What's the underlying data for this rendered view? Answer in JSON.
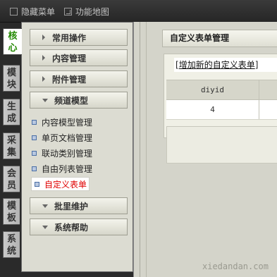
{
  "topbar": {
    "hide_menu": "隐藏菜单",
    "feature_map": "功能地图"
  },
  "vtabs": [
    {
      "label": "核\n心",
      "active": true
    },
    {
      "label": "模\n块",
      "active": false
    },
    {
      "label": "生\n成",
      "active": false
    },
    {
      "label": "采\n集",
      "active": false
    },
    {
      "label": "会\n员",
      "active": false
    },
    {
      "label": "模\n板",
      "active": false
    },
    {
      "label": "系\n统",
      "active": false
    }
  ],
  "menu": {
    "sections": [
      {
        "label": "常用操作",
        "expanded": false
      },
      {
        "label": "内容管理",
        "expanded": false
      },
      {
        "label": "附件管理",
        "expanded": false
      },
      {
        "label": "频道模型",
        "expanded": true
      },
      {
        "label": "批里维护",
        "expanded": false
      },
      {
        "label": "系统帮助",
        "expanded": false
      }
    ],
    "channel_items": [
      {
        "label": "内容模型管理",
        "active": false
      },
      {
        "label": "单页文档管理",
        "active": false
      },
      {
        "label": "联动类别管理",
        "active": false
      },
      {
        "label": "自由列表管理",
        "active": false
      },
      {
        "label": "自定义表单",
        "active": true
      }
    ]
  },
  "main": {
    "title": "自定义表单管理",
    "add_link_prefix": "[",
    "add_link": "增加新的自定义表单",
    "add_link_suffix": "]",
    "table": {
      "columns": [
        "diyid"
      ],
      "rows": [
        [
          "4"
        ]
      ]
    }
  },
  "watermark": "xiedandan.com",
  "colors": {
    "active_tab_text": "#228800",
    "active_item_text": "#e00000",
    "panel_bg": "#dcdcd2",
    "topbar_bg": "#2e2e2e"
  }
}
